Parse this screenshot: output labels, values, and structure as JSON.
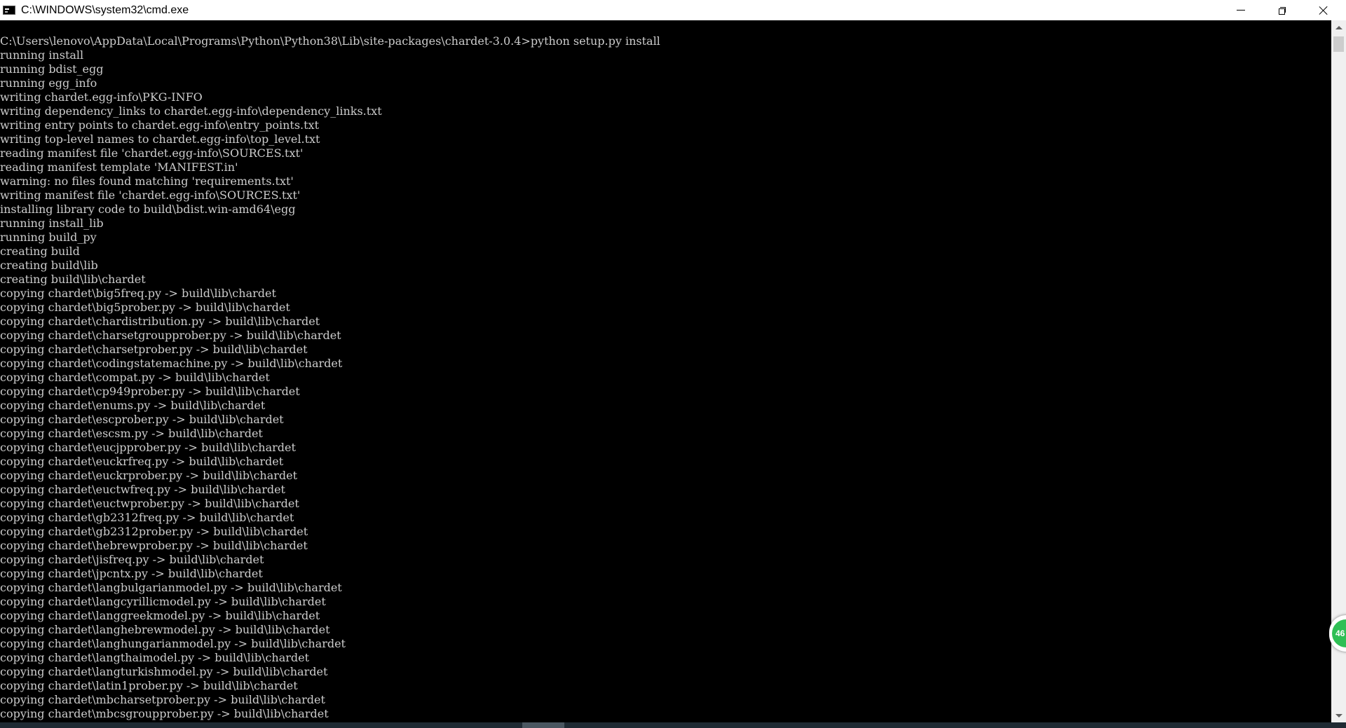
{
  "window": {
    "title": "C:\\WINDOWS\\system32\\cmd.exe"
  },
  "colors": {
    "console_background": "#000000",
    "console_text": "#cccccc",
    "titlebar_background": "#ffffff",
    "badge_green": "#2fbf55"
  },
  "icons": {
    "app": "console-app-icon",
    "minimize": "minimize-icon",
    "maximize": "restore-icon",
    "close": "close-icon",
    "scroll_up": "arrow-up-icon",
    "scroll_down": "arrow-down-icon"
  },
  "badge": {
    "text": "46"
  },
  "console": {
    "lines": [
      "C:\\Users\\lenovo\\AppData\\Local\\Programs\\Python\\Python38\\Lib\\site-packages\\chardet-3.0.4>python setup.py install",
      "running install",
      "running bdist_egg",
      "running egg_info",
      "writing chardet.egg-info\\PKG-INFO",
      "writing dependency_links to chardet.egg-info\\dependency_links.txt",
      "writing entry points to chardet.egg-info\\entry_points.txt",
      "writing top-level names to chardet.egg-info\\top_level.txt",
      "reading manifest file 'chardet.egg-info\\SOURCES.txt'",
      "reading manifest template 'MANIFEST.in'",
      "warning: no files found matching 'requirements.txt'",
      "writing manifest file 'chardet.egg-info\\SOURCES.txt'",
      "installing library code to build\\bdist.win-amd64\\egg",
      "running install_lib",
      "running build_py",
      "creating build",
      "creating build\\lib",
      "creating build\\lib\\chardet",
      "copying chardet\\big5freq.py -> build\\lib\\chardet",
      "copying chardet\\big5prober.py -> build\\lib\\chardet",
      "copying chardet\\chardistribution.py -> build\\lib\\chardet",
      "copying chardet\\charsetgroupprober.py -> build\\lib\\chardet",
      "copying chardet\\charsetprober.py -> build\\lib\\chardet",
      "copying chardet\\codingstatemachine.py -> build\\lib\\chardet",
      "copying chardet\\compat.py -> build\\lib\\chardet",
      "copying chardet\\cp949prober.py -> build\\lib\\chardet",
      "copying chardet\\enums.py -> build\\lib\\chardet",
      "copying chardet\\escprober.py -> build\\lib\\chardet",
      "copying chardet\\escsm.py -> build\\lib\\chardet",
      "copying chardet\\eucjpprober.py -> build\\lib\\chardet",
      "copying chardet\\euckrfreq.py -> build\\lib\\chardet",
      "copying chardet\\euckrprober.py -> build\\lib\\chardet",
      "copying chardet\\euctwfreq.py -> build\\lib\\chardet",
      "copying chardet\\euctwprober.py -> build\\lib\\chardet",
      "copying chardet\\gb2312freq.py -> build\\lib\\chardet",
      "copying chardet\\gb2312prober.py -> build\\lib\\chardet",
      "copying chardet\\hebrewprober.py -> build\\lib\\chardet",
      "copying chardet\\jisfreq.py -> build\\lib\\chardet",
      "copying chardet\\jpcntx.py -> build\\lib\\chardet",
      "copying chardet\\langbulgarianmodel.py -> build\\lib\\chardet",
      "copying chardet\\langcyrillicmodel.py -> build\\lib\\chardet",
      "copying chardet\\langgreekmodel.py -> build\\lib\\chardet",
      "copying chardet\\langhebrewmodel.py -> build\\lib\\chardet",
      "copying chardet\\langhungarianmodel.py -> build\\lib\\chardet",
      "copying chardet\\langthaimodel.py -> build\\lib\\chardet",
      "copying chardet\\langturkishmodel.py -> build\\lib\\chardet",
      "copying chardet\\latin1prober.py -> build\\lib\\chardet",
      "copying chardet\\mbcharsetprober.py -> build\\lib\\chardet",
      "copying chardet\\mbcsgroupprober.py -> build\\lib\\chardet"
    ]
  }
}
